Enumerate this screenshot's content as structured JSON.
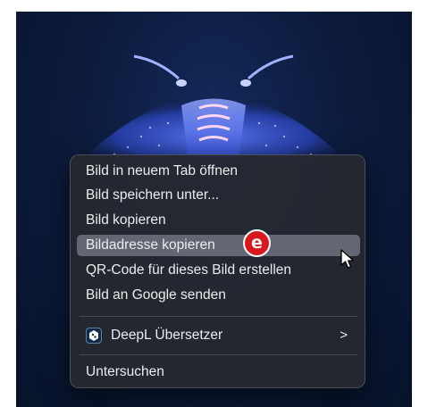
{
  "context_menu": {
    "items": [
      {
        "label": "Bild in neuem Tab öffnen"
      },
      {
        "label": "Bild speichern unter..."
      },
      {
        "label": "Bild kopieren"
      },
      {
        "label": "Bildadresse kopieren",
        "highlighted": true
      },
      {
        "label": "QR-Code für dieses Bild erstellen"
      },
      {
        "label": "Bild an Google senden"
      }
    ],
    "extension_item": {
      "label": "DeepL Übersetzer",
      "icon": "deepl-icon",
      "submenu_indicator": ">"
    },
    "inspect_item": {
      "label": "Untersuchen"
    }
  },
  "annotation": {
    "badge_text": "e",
    "color": "#d7191f"
  },
  "colors": {
    "menu_background": "#26282f",
    "highlight": "#787c8a",
    "photo_background": "#0d1c3e",
    "creature_glow": "#4a7dff"
  }
}
